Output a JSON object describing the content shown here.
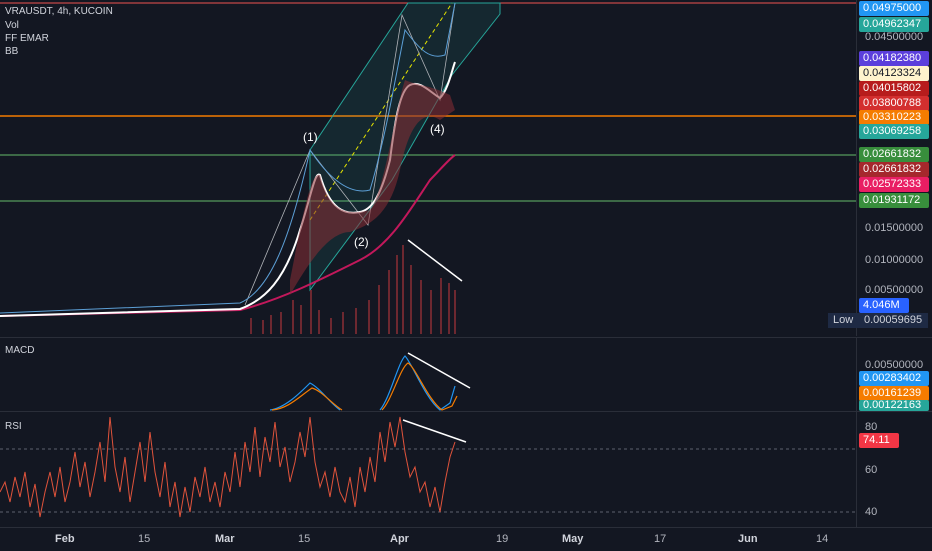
{
  "legend": {
    "symbol": "VRAUSDT, 4h, KUCOIN",
    "vol": "Vol",
    "ema": "FF EMAR",
    "bb": "BB"
  },
  "macd_label": "MACD",
  "rsi_label": "RSI",
  "waves": [
    "(1)",
    "(2)",
    "(4)"
  ],
  "price_ticks": [
    "0.04500000",
    "0.01500000",
    "0.01000000",
    "0.00500000"
  ],
  "price_tags": [
    {
      "text": "0.04975000",
      "color": "#2196f3"
    },
    {
      "text": "0.04962347",
      "color": "#26a69a"
    },
    {
      "text": "0.04182380",
      "color": "#5b3fdc"
    },
    {
      "text": "0.04123324",
      "color": "#fff3cd"
    },
    {
      "text": "0.04015802",
      "color": "#b71c1c"
    },
    {
      "text": "0.03800788",
      "color": "#d32f2f"
    },
    {
      "text": "0.03310223",
      "color": "#f57c00"
    },
    {
      "text": "0.03069258",
      "color": "#26a69a"
    },
    {
      "text": "0.02661832",
      "color": "#388e3c"
    },
    {
      "text": "0.02661832",
      "color": "#a5282c"
    },
    {
      "text": "0.02572333",
      "color": "#e91e63"
    },
    {
      "text": "0.01931172",
      "color": "#388e3c"
    },
    {
      "text": "4.046M",
      "color": "#2962ff"
    }
  ],
  "low_label": "Low",
  "low_value": "0.00059695",
  "macd_ticks": [
    "0.00500000"
  ],
  "macd_tags": [
    {
      "text": "0.00283402",
      "color": "#2196f3"
    },
    {
      "text": "0.00161239",
      "color": "#f57c00"
    },
    {
      "text": "0.00122163",
      "color": "#26a69a"
    }
  ],
  "rsi_ticks": [
    "80",
    "60",
    "40"
  ],
  "rsi_value": "74.11",
  "time_labels": [
    {
      "text": "Feb",
      "month": true
    },
    {
      "text": "15",
      "month": false
    },
    {
      "text": "Mar",
      "month": true
    },
    {
      "text": "15",
      "month": false
    },
    {
      "text": "Apr",
      "month": true
    },
    {
      "text": "19",
      "month": false
    },
    {
      "text": "May",
      "month": true
    },
    {
      "text": "17",
      "month": false
    },
    {
      "text": "Jun",
      "month": true
    },
    {
      "text": "14",
      "month": false
    }
  ],
  "colors": {
    "background": "#131722",
    "price_line": "#ffffff",
    "ema": "#c2185b",
    "channel": "#26a69a",
    "horizontal_orange": "#f57c00",
    "horizontal_green": "#66bb6a",
    "rsi_line": "#e0533b",
    "macd_line": "#2196f3",
    "signal_line": "#f57c00"
  }
}
